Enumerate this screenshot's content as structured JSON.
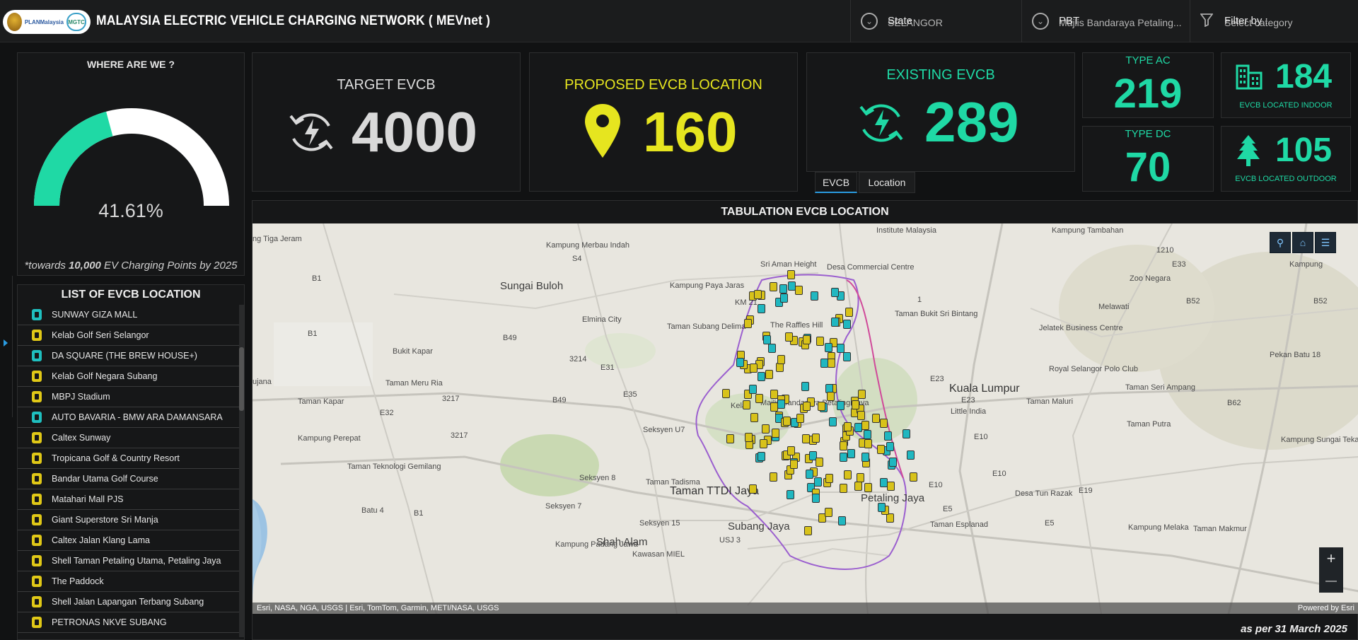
{
  "header": {
    "logo": {
      "plan_text": "PLANMalaysia",
      "mgtc_text": "MGTC"
    },
    "title": "MALAYSIA ELECTRIC VEHICLE CHARGING NETWORK ( MEVnet )",
    "filters": [
      {
        "label": "State",
        "value": "SELANGOR",
        "icon": "chevron-circle-icon"
      },
      {
        "label": "PBT",
        "value": "Majlis Bandaraya Petaling...",
        "icon": "chevron-circle-icon"
      },
      {
        "label": "Filter by :",
        "value": "Select category",
        "icon": "funnel-icon"
      }
    ]
  },
  "gauge": {
    "title": "WHERE ARE WE ?",
    "percent_text": "41.61%",
    "fraction": 0.4161,
    "note_prefix": "*towards ",
    "note_bold": "10,000",
    "note_suffix": " EV Charging Points by 2025",
    "colors": {
      "fill": "#1fd9a5",
      "track": "#ffffff"
    }
  },
  "kpis": {
    "target": {
      "title": "TARGET EVCB",
      "value": "4000",
      "icon": "charging-cycle-icon",
      "color": "#d9d9d9"
    },
    "proposed": {
      "title": "PROPOSED EVCB LOCATION",
      "value": "160",
      "icon": "map-pin-icon",
      "color": "#e6e51f"
    },
    "existing": {
      "title": "EXISTING EVCB",
      "value": "289",
      "icon": "charging-cycle-icon",
      "color": "#1fd9a5"
    },
    "type_ac": {
      "title": "TYPE AC",
      "value": "219",
      "color": "#1fd9a5"
    },
    "type_dc": {
      "title": "TYPE DC",
      "value": "70",
      "color": "#1fd9a5"
    },
    "indoor": {
      "value": "184",
      "caption": "EVCB LOCATED INDOOR",
      "icon": "building-icon",
      "color": "#1fd9a5"
    },
    "outdoor": {
      "value": "105",
      "caption": "EVCB LOCATED OUTDOOR",
      "icon": "tree-icon",
      "color": "#1fd9a5"
    }
  },
  "tabs": [
    {
      "label": "EVCB",
      "active": true
    },
    {
      "label": "Location",
      "active": false
    }
  ],
  "list": {
    "title": "LIST OF EVCB LOCATION",
    "items": [
      {
        "name": "SUNWAY GIZA MALL",
        "type": "dc"
      },
      {
        "name": "Kelab Golf Seri Selangor",
        "type": "ac"
      },
      {
        "name": "DA SQUARE (THE BREW HOUSE+)",
        "type": "dc"
      },
      {
        "name": "Kelab Golf Negara Subang",
        "type": "ac"
      },
      {
        "name": "MBPJ Stadium",
        "type": "ac"
      },
      {
        "name": "AUTO BAVARIA - BMW ARA DAMANSARA",
        "type": "dc"
      },
      {
        "name": "Caltex Sunway",
        "type": "ac"
      },
      {
        "name": "Tropicana Golf & Country Resort",
        "type": "ac"
      },
      {
        "name": "Bandar Utama Golf Course",
        "type": "ac"
      },
      {
        "name": "Matahari Mall PJS",
        "type": "ac"
      },
      {
        "name": "Giant Superstore Sri Manja",
        "type": "ac"
      },
      {
        "name": "Caltex Jalan Klang Lama",
        "type": "ac"
      },
      {
        "name": "Shell Taman Petaling Utama, Petaling Jaya",
        "type": "ac"
      },
      {
        "name": "The Paddock",
        "type": "ac"
      },
      {
        "name": "Shell Jalan Lapangan Terbang Subang",
        "type": "ac"
      },
      {
        "name": "PETRONAS NKVE SUBANG",
        "type": "ac"
      }
    ]
  },
  "map": {
    "title": "TABULATION EVCB LOCATION",
    "attribution": "Esri, NASA, NGA, USGS | Esri, TomTom, Garmin, METI/NASA, USGS",
    "powered_by": "Powered by Esri",
    "tools": [
      "search-icon",
      "home-icon",
      "layers-icon"
    ],
    "zoom_in": "+",
    "zoom_out": "—",
    "labels": {
      "sungai_buloh": "Sungai Buloh",
      "kuala_lumpur": "Kuala Lumpur",
      "taman_ttdi_jaya": "Taman TTDI Jaya",
      "subang_jaya": "Subang Jaya",
      "petaling_jaya": "Petaling Jaya",
      "shah_alam": "Shah Alam",
      "kampung_merbau_indah": "Kampung Merbau Indah",
      "sri_aman_height": "Sri Aman Height",
      "desa_commercial_centre": "Desa Commercial Centre",
      "kampung_paya_jaras": "Kampung Paya Jaras",
      "km21": "KM 21",
      "elmina_city": "Elmina City",
      "taman_subang_delima": "Taman Subang Delima",
      "the_raffles_hill": "The Raffles Hill",
      "taman_bukit_sri_bintang": "Taman Bukit Sri Bintang",
      "bukit_kapar": "Bukit Kapar",
      "taman_meru_ria": "Taman Meru Ria",
      "taman_kapar": "Taman Kapar",
      "kampung_perepat": "Kampung Perepat",
      "taman_teknologi_gemilang": "Taman Teknologi Gemilang",
      "seksyen_u7": "Seksyen U7",
      "seksyen_8": "Seksyen 8",
      "seksyen_7": "Seksyen 7",
      "seksyen_15": "Seksyen 15",
      "taman_tadisma": "Taman Tadisma",
      "batu_4": "Batu 4",
      "usj3": "USJ 3",
      "kampung_padang_jawa": "Kampung Padang Jawa",
      "kawasan_miel": "Kawasan MIEL",
      "melawati": "Melawati",
      "zoo_negara": "Zoo Negara",
      "jelatek": "Jelatek Business Centre",
      "royal_selangor": "Royal Selangor Polo Club",
      "little_india": "Little India",
      "taman_maluri": "Taman Maluri",
      "taman_seri_ampang": "Taman Seri Ampang",
      "taman_putra": "Taman Putra",
      "kampung_sungai_tekali": "Kampung Sungai Tekali",
      "pekan_batu_18": "Pekan Batu 18",
      "desa_tun_razak": "Desa Tun Razak",
      "taman_esplanad": "Taman Esplanad",
      "kampung_melaka": "Kampung Melaka",
      "taman_makmur": "Taman Makmur",
      "kampung_tambahan": "Kampung Tambahan",
      "institute": "Institute Malaysia",
      "kampung_batu": "Kampung",
      "kelab": "Kelab",
      "mbpj": "Majlis Bandaraya Petaling Jaya",
      "ju_jana": "ujana",
      "tiga_jeram": "ng Tiga Jeram",
      "road_1210": "1210",
      "road_s4": "S4",
      "road_b1a": "B1",
      "road_b1b": "B1",
      "road_b49a": "B49",
      "road_3214": "3214",
      "road_e31": "E31",
      "road_e35": "E35",
      "road_b49b": "B49",
      "road_3217a": "3217",
      "road_3217b": "3217",
      "road_e32": "E32",
      "road_e33": "E33",
      "road_1": "1",
      "road_e23a": "E23",
      "road_e23b": "E23",
      "road_e10a": "E10",
      "road_e10b": "E10",
      "road_e19": "E19",
      "road_e5a": "E5",
      "road_e5b": "E5",
      "road_b52a": "B52",
      "road_b52b": "B52",
      "road_b62": "B62",
      "road_b1c": "B1",
      "road_e10c": "E10",
      "road_kamp_tambahan": "Kampung"
    }
  },
  "footer_note": "as per 31 March 2025"
}
